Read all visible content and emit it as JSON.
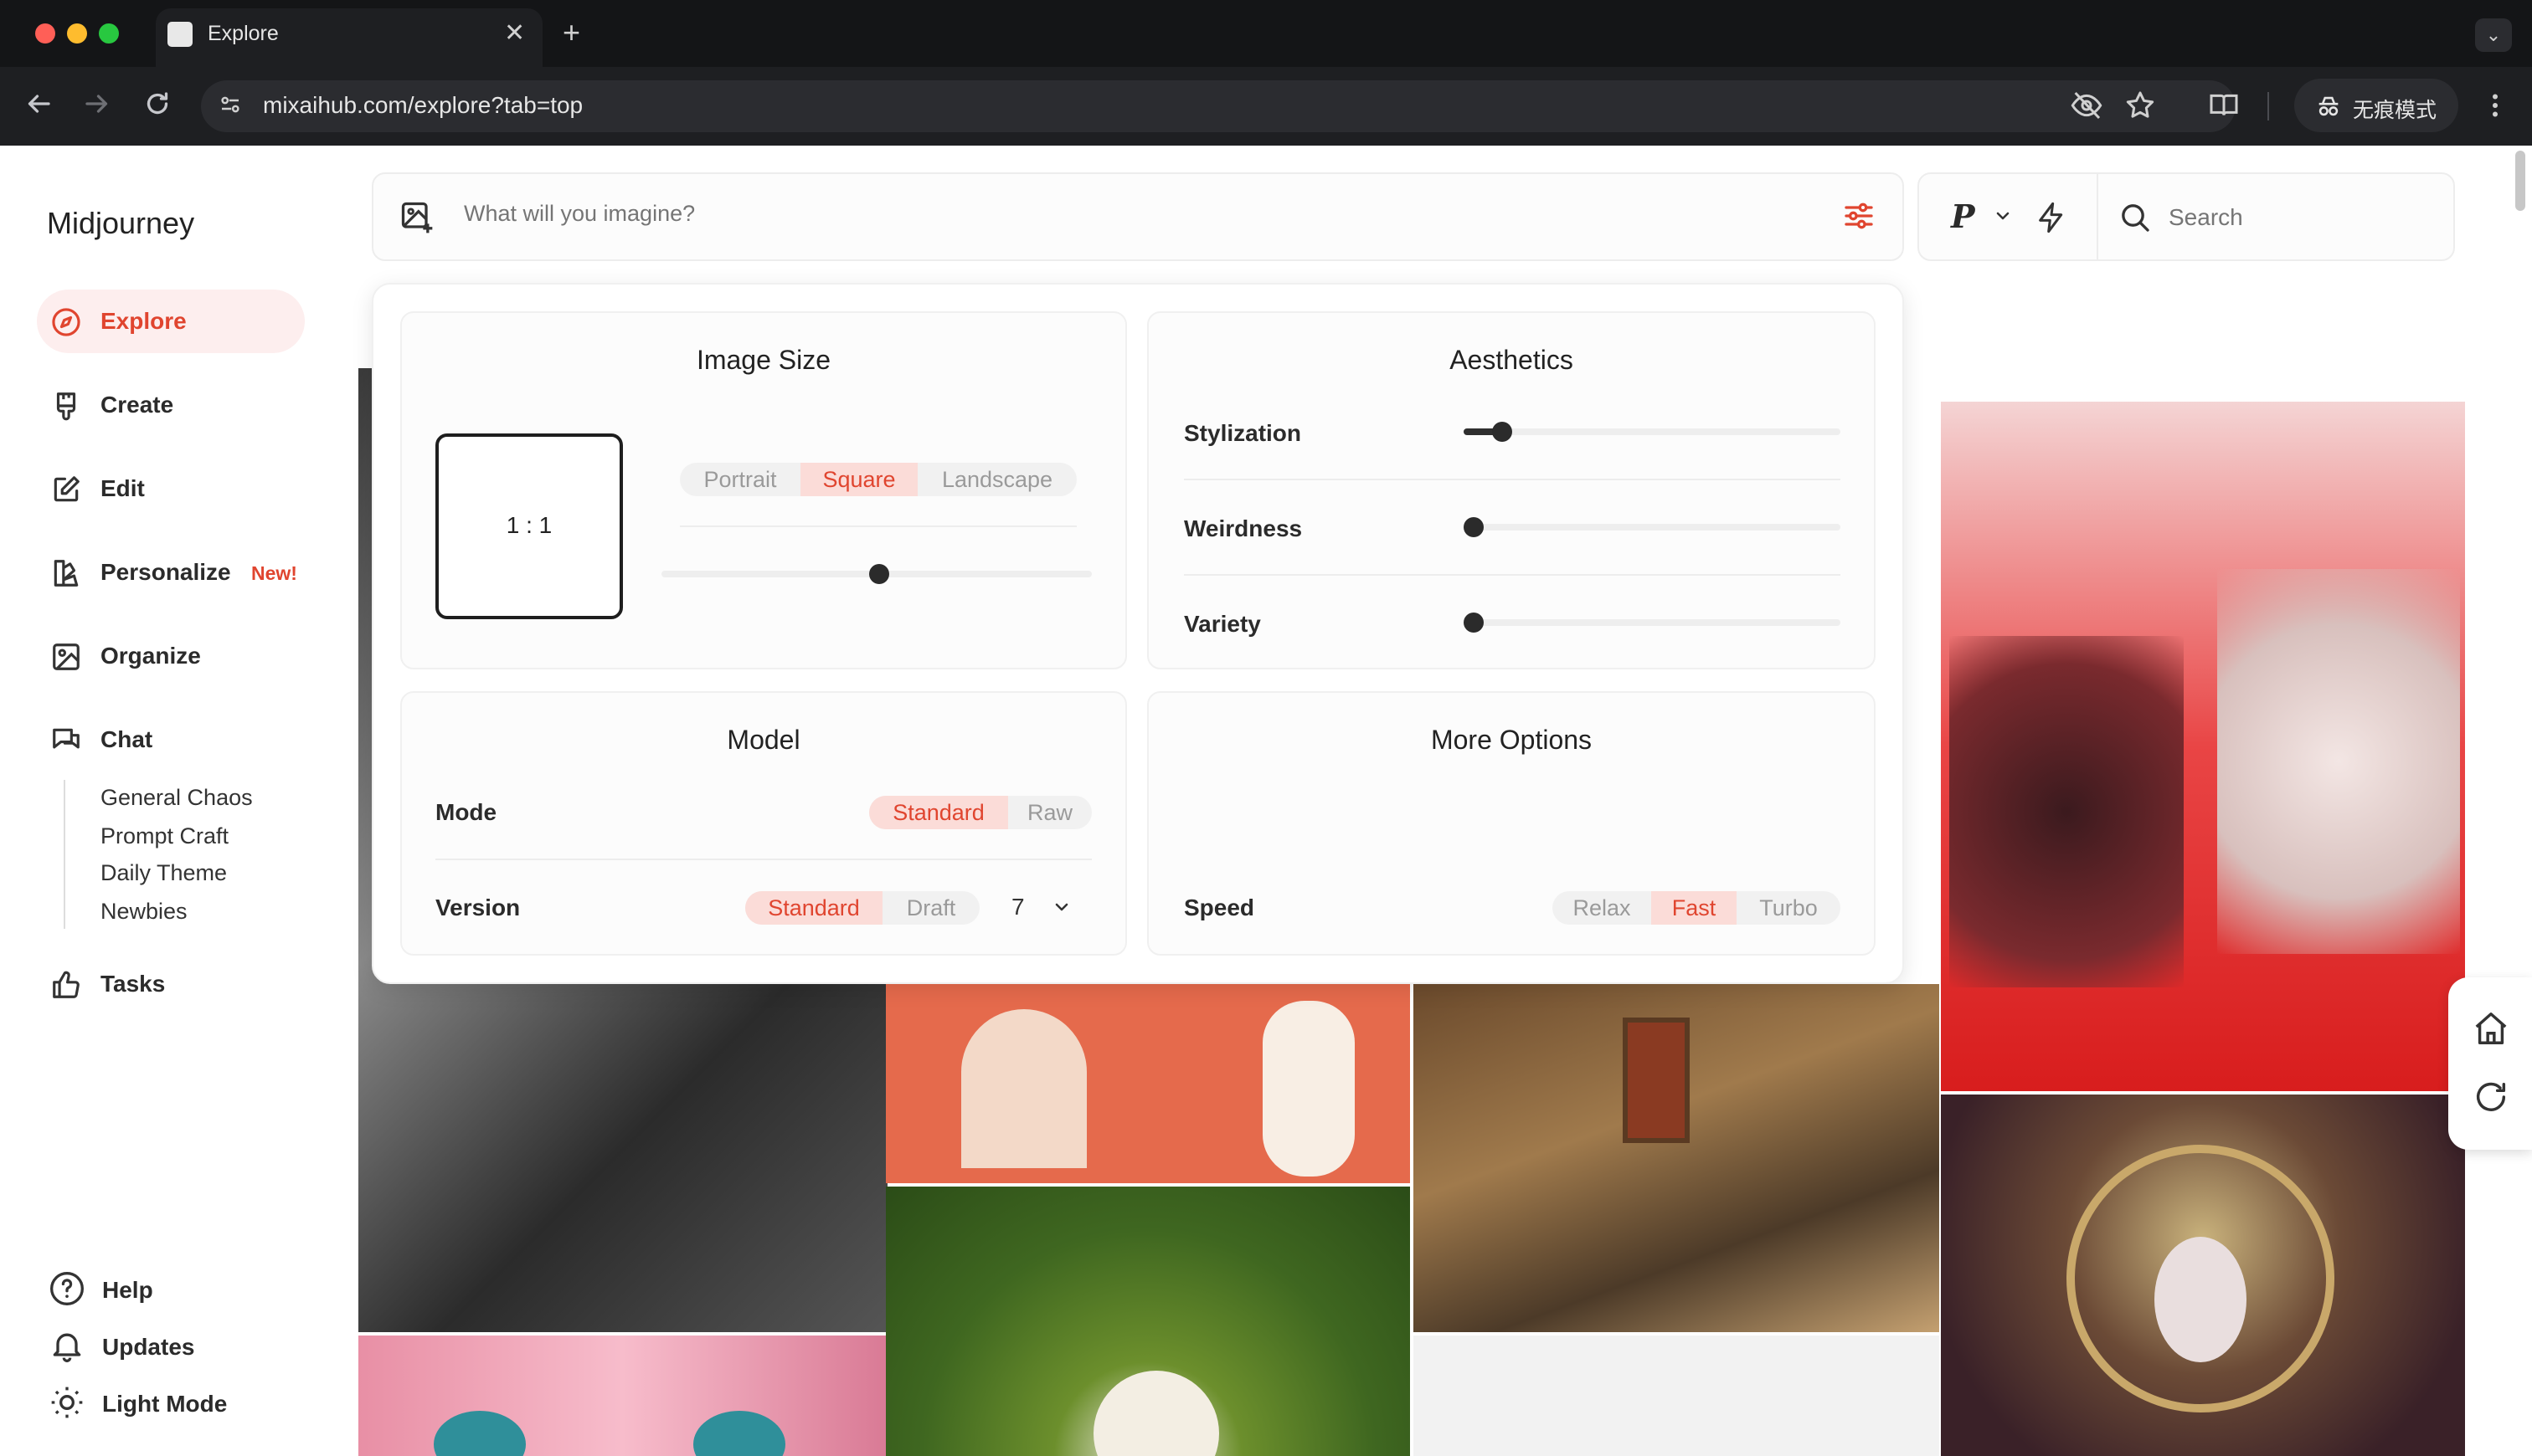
{
  "browser": {
    "tab_title": "Explore",
    "url": "mixaihub.com/explore?tab=top",
    "incognito_label": "无痕模式",
    "new_tab_symbol": "+",
    "close_symbol": "✕"
  },
  "sidebar": {
    "brand": "Midjourney",
    "items": [
      {
        "label": "Explore",
        "icon": "compass-icon",
        "active": true
      },
      {
        "label": "Create",
        "icon": "paintbrush-icon"
      },
      {
        "label": "Edit",
        "icon": "edit-icon"
      },
      {
        "label": "Personalize",
        "icon": "personalize-icon",
        "badge": "New!"
      },
      {
        "label": "Organize",
        "icon": "image-icon"
      },
      {
        "label": "Chat",
        "icon": "chat-icon"
      }
    ],
    "chat_rooms": [
      "General Chaos",
      "Prompt Craft",
      "Daily Theme",
      "Newbies"
    ],
    "tasks_label": "Tasks",
    "bottom": [
      {
        "label": "Help",
        "icon": "help-icon"
      },
      {
        "label": "Updates",
        "icon": "bell-icon"
      },
      {
        "label": "Light Mode",
        "icon": "sun-icon"
      }
    ]
  },
  "prompt": {
    "placeholder": "What will you imagine?",
    "personalize_label": "P",
    "search_placeholder": "Search"
  },
  "settings": {
    "image_size": {
      "title": "Image Size",
      "ratio": "1 : 1",
      "orientations": [
        "Portrait",
        "Square",
        "Landscape"
      ],
      "selected_orientation": "Square",
      "slider_value": 0.5
    },
    "aesthetics": {
      "title": "Aesthetics",
      "sliders": [
        {
          "label": "Stylization",
          "value": 0.1
        },
        {
          "label": "Weirdness",
          "value": 0.0
        },
        {
          "label": "Variety",
          "value": 0.0
        }
      ]
    },
    "model": {
      "title": "Model",
      "mode_label": "Mode",
      "modes": [
        "Standard",
        "Raw"
      ],
      "selected_mode": "Standard",
      "version_label": "Version",
      "version_types": [
        "Standard",
        "Draft"
      ],
      "selected_version_type": "Standard",
      "version_number": "7"
    },
    "more_options": {
      "title": "More Options",
      "speed_label": "Speed",
      "speeds": [
        "Relax",
        "Fast",
        "Turbo"
      ],
      "selected_speed": "Fast"
    }
  },
  "colors": {
    "accent": "#e0452f",
    "accent_bg": "#fbdcd8"
  }
}
